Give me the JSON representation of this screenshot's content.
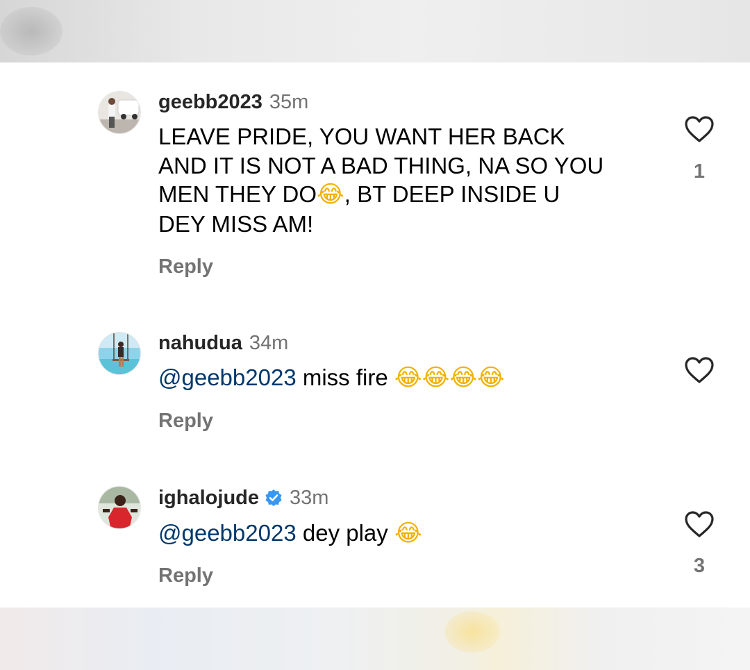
{
  "comments": [
    {
      "username": "geebb2023",
      "time": "35m",
      "verified": false,
      "text_lines": [
        "LEAVE PRIDE, YOU WANT HER BACK",
        "AND IT IS NOT A BAD THING, NA SO YOU",
        "MEN THEY DO",
        ", BT DEEP INSIDE U",
        "DEY MISS AM!"
      ],
      "emoji": "😂",
      "reply_label": "Reply",
      "like_count": "1",
      "avatar_icon": "car-photo-avatar"
    },
    {
      "username": "nahudua",
      "time": "34m",
      "verified": false,
      "mention": "@geebb2023",
      "text": "miss fire",
      "emoji": "😂😂😂😂",
      "reply_label": "Reply",
      "like_count": "",
      "avatar_icon": "beach-swing-avatar"
    },
    {
      "username": "ighalojude",
      "time": "33m",
      "verified": true,
      "mention": "@geebb2023",
      "text": "dey play",
      "emoji": "😂",
      "reply_label": "Reply",
      "like_count": "3",
      "avatar_icon": "red-jersey-avatar"
    }
  ],
  "colors": {
    "username": "#262626",
    "meta": "#737373",
    "mention": "#00376b",
    "verified": "#3897f0"
  }
}
